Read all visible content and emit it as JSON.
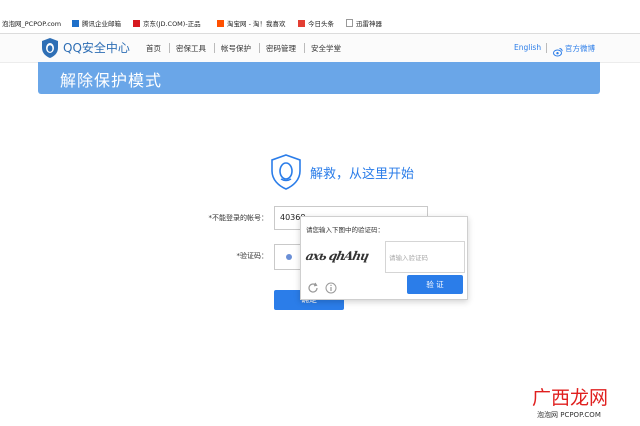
{
  "bookmarks": [
    {
      "label": "泡泡网_PCPOP.com",
      "icon": "page-icon",
      "color": "#999999"
    },
    {
      "label": "腾讯企业邮箱",
      "icon": "mail-icon",
      "color": "#1e6fc9"
    },
    {
      "label": "京东(JD.COM)-正品",
      "icon": "jd-icon",
      "color": "#d71920"
    },
    {
      "label": "淘宝网 - 淘！我喜欢",
      "icon": "taobao-icon",
      "color": "#ff5000"
    },
    {
      "label": "今日头条",
      "icon": "toutiao-icon",
      "color": "#e33e33"
    },
    {
      "label": "迅雷神器",
      "icon": "page-icon",
      "color": "#999999"
    }
  ],
  "header": {
    "logo_text": "QQ安全中心",
    "nav": [
      "首页",
      "密保工具",
      "帐号保护",
      "密码管理",
      "安全学堂"
    ],
    "lang_link": "English",
    "weibo_link": "官方微博"
  },
  "banner": {
    "title": "解除保护模式"
  },
  "rescue": {
    "heading": "解救，从这里开始"
  },
  "form": {
    "account_label": "*不能登录的帐号：",
    "account_value": "40368",
    "captcha_label": "*验证码：",
    "submit_label": "确定"
  },
  "captcha_popup": {
    "title": "请您输入下图中的验证码：",
    "captcha_image_text": "ахь qhAhɥ",
    "input_placeholder": "请输入验证码",
    "verify_label": "验 证"
  },
  "watermark": {
    "brand": "广西龙网",
    "site": "泡泡网 PCPOP.COM"
  },
  "colors": {
    "banner": "#6aa6e8",
    "accent": "#2b7de9",
    "logo": "#2f6fb5",
    "watermark_red": "#e0201f"
  }
}
